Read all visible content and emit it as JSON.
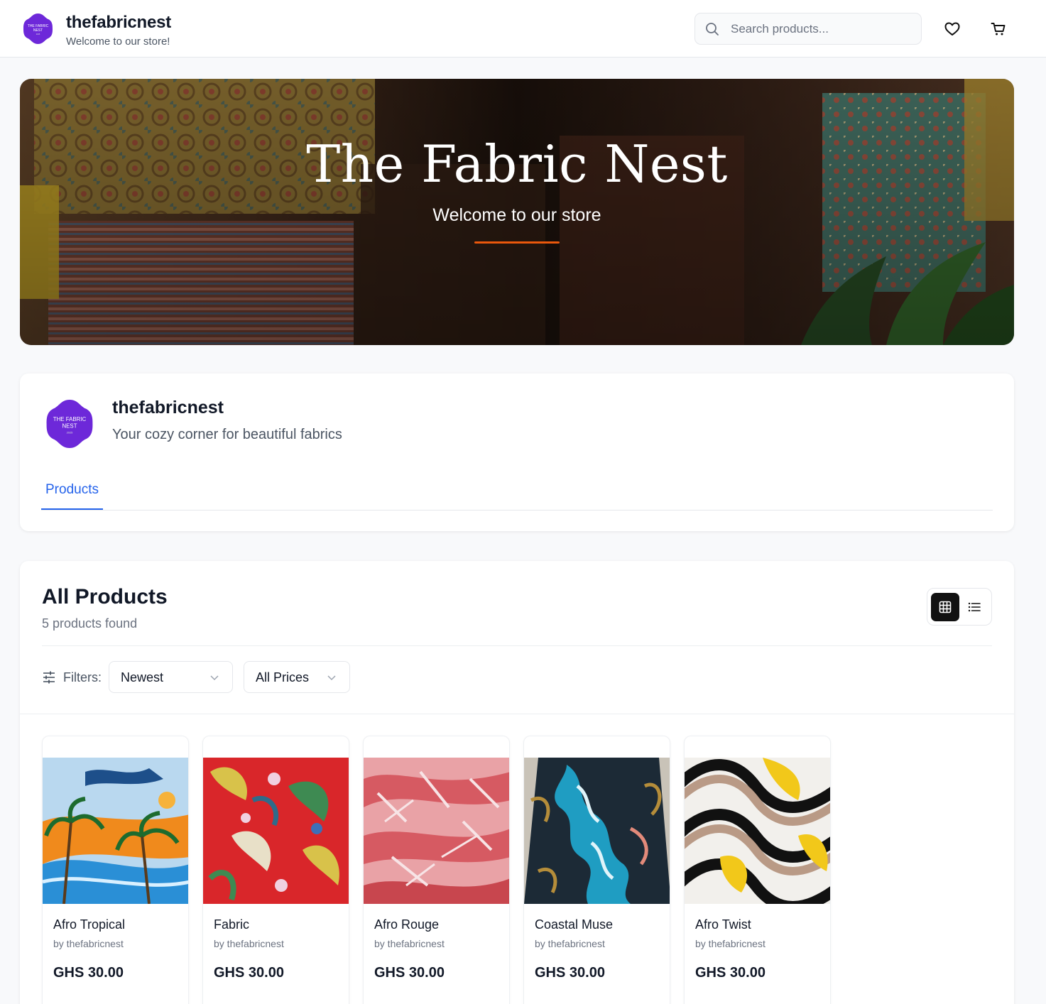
{
  "header": {
    "brand_name": "thefabricnest",
    "brand_tagline": "Welcome to our store!",
    "search_placeholder": "Search products..."
  },
  "logo": {
    "line1": "THE FABRIC",
    "line2": "NEST",
    "line3": "2025",
    "color": "#6d28d9"
  },
  "hero": {
    "title": "The Fabric Nest",
    "subtitle": "Welcome to our store",
    "accent_color": "#ea580c"
  },
  "store": {
    "name": "thefabricnest",
    "description": "Your cozy corner for beautiful fabrics",
    "tabs": [
      {
        "label": "Products",
        "active": true
      }
    ]
  },
  "products_section": {
    "title": "All Products",
    "count_text": "5 products found",
    "filters_label": "Filters:",
    "sort_selected": "Newest",
    "price_selected": "All Prices",
    "view_mode": "grid"
  },
  "products": [
    {
      "name": "Afro Tropical",
      "seller": "by thefabricnest",
      "price": "GHS 30.00"
    },
    {
      "name": "Fabric",
      "seller": "by thefabricnest",
      "price": "GHS 30.00"
    },
    {
      "name": "Afro Rouge",
      "seller": "by thefabricnest",
      "price": "GHS 30.00"
    },
    {
      "name": "Coastal Muse",
      "seller": "by thefabricnest",
      "price": "GHS 30.00"
    },
    {
      "name": "Afro Twist",
      "seller": "by thefabricnest",
      "price": "GHS 30.00"
    }
  ],
  "colors": {
    "primary_link": "#2563eb",
    "text_dark": "#111827",
    "text_muted": "#6b7280"
  }
}
